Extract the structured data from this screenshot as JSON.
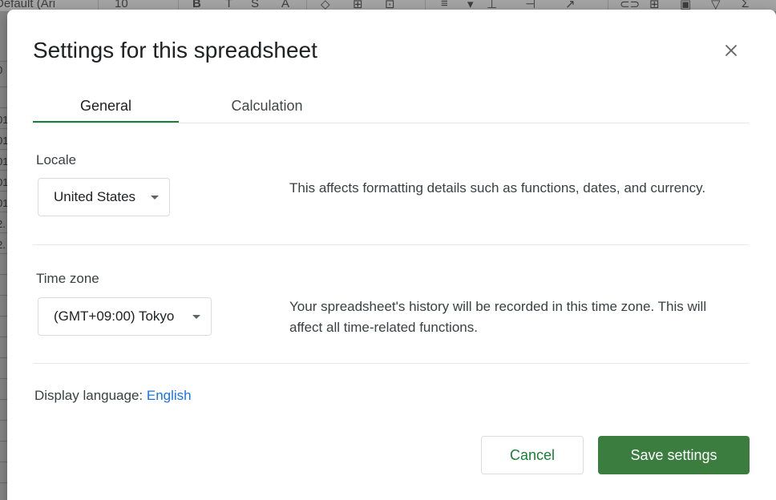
{
  "background": {
    "toolbar": {
      "font_name": "Default (Ari",
      "font_size": "10",
      "icons": [
        "bold-icon",
        "strikethrough-icon",
        "strikethrough-s-icon",
        "text-color-icon",
        "fill-color-icon",
        "borders-icon",
        "merge-icon",
        "align-icon",
        "valign-icon",
        "wrap-icon",
        "rotate-icon",
        "link-icon",
        "comment-icon",
        "chart-icon",
        "filter-icon",
        "functions-icon"
      ]
    },
    "cells": [
      "0",
      "l",
      "01",
      "01",
      "01",
      "01",
      "01",
      "2.",
      "2."
    ]
  },
  "dialog": {
    "title": "Settings for this spreadsheet",
    "close_label": "×",
    "tabs": [
      {
        "label": "General",
        "selected": true
      },
      {
        "label": "Calculation",
        "selected": false
      }
    ],
    "locale": {
      "label": "Locale",
      "value": "United States",
      "description": "This affects formatting details such as functions, dates, and currency."
    },
    "timezone": {
      "label": "Time zone",
      "value": "(GMT+09:00) Tokyo",
      "description": "Your spreadsheet's history will be recorded in this time zone. This will affect all time-related functions."
    },
    "display_language": {
      "label": "Display language:",
      "value": "English"
    },
    "buttons": {
      "cancel": "Cancel",
      "save": "Save settings"
    }
  },
  "colors": {
    "accent_green": "#188038",
    "save_button": "#3a7d3f",
    "link_blue": "#1a73e8"
  }
}
